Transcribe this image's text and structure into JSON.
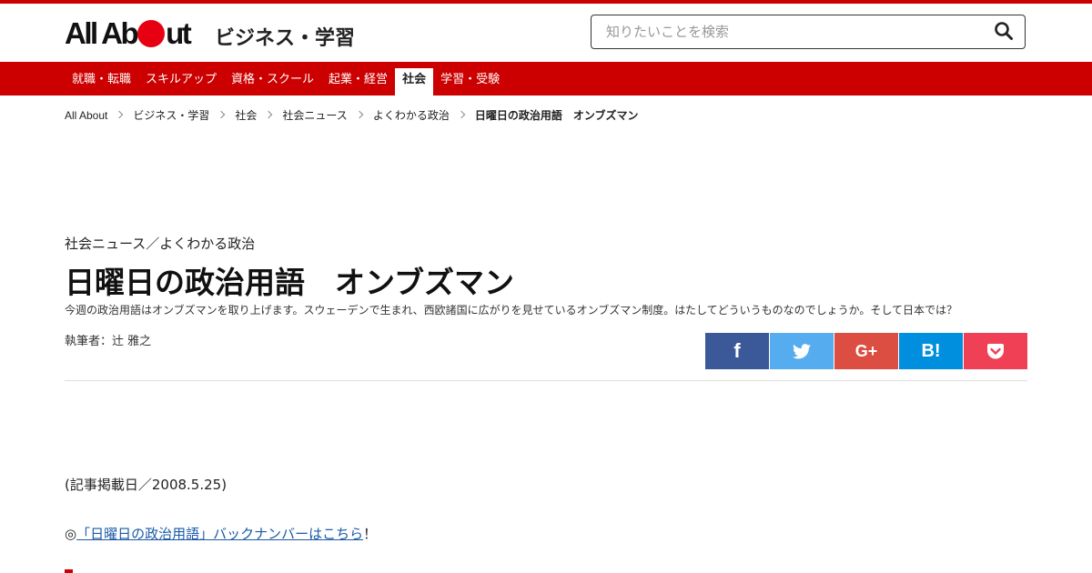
{
  "header": {
    "logo_text": "All About",
    "site_title": "ビジネス・学習",
    "search_placeholder": "知りたいことを検索"
  },
  "nav": {
    "items": [
      {
        "label": "就職・転職"
      },
      {
        "label": "スキルアップ"
      },
      {
        "label": "資格・スクール"
      },
      {
        "label": "起業・経営"
      },
      {
        "label": "社会",
        "active": true
      },
      {
        "label": "学習・受験"
      }
    ]
  },
  "breadcrumb": {
    "items": [
      "All About",
      "ビジネス・学習",
      "社会",
      "社会ニュース",
      "よくわかる政治"
    ],
    "current": "日曜日の政治用語　オンブズマン"
  },
  "article": {
    "category": "社会ニュース／よくわかる政治",
    "title": "日曜日の政治用語　オンブズマン",
    "lead": "今週の政治用語はオンブズマンを取り上げます。スウェーデンで生まれ、西欧諸国に広がりを見せているオンブズマン制度。はたしてどういうものなのでしょうか。そして日本では？",
    "author": "執筆者：辻 雅之",
    "posted": "(記事掲載日／2008.5.25)",
    "backnumber_prefix": "◎",
    "backnumber_link": "「日曜日の政治用語」バックナンバーはこちら",
    "backnumber_suffix": "！"
  },
  "share": {
    "buttons": [
      {
        "name": "facebook",
        "glyph": "f",
        "color": "#3b5998"
      },
      {
        "name": "twitter",
        "glyph": "",
        "color": "#55acee"
      },
      {
        "name": "google-plus",
        "glyph": "G+",
        "color": "#dc4e41"
      },
      {
        "name": "hatena-bookmark",
        "glyph": "B!",
        "color": "#008fde"
      },
      {
        "name": "pocket",
        "glyph": "",
        "color": "#ef4056"
      }
    ]
  },
  "colors": {
    "brand_red": "#cc0000",
    "logo_dot": "#e60012",
    "link": "#1a5aa8"
  }
}
